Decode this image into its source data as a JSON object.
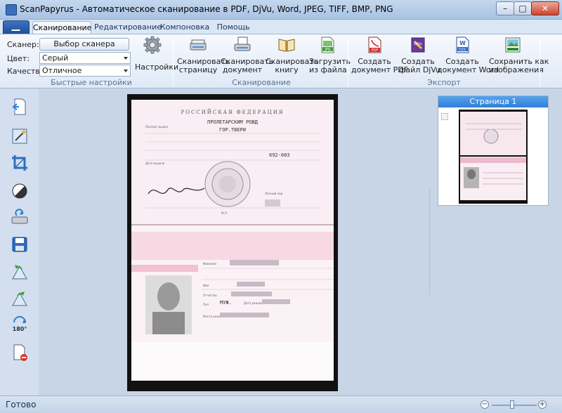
{
  "window": {
    "title": "ScanPapyrus - Автоматическое сканирование в PDF, DjVu, Word, JPEG, TIFF, BMP, PNG",
    "min": "–",
    "max": "□",
    "close": "✕"
  },
  "tabs": [
    {
      "label": "Сканирование",
      "active": true
    },
    {
      "label": "Редактирование",
      "active": false
    },
    {
      "label": "Компоновка",
      "active": false
    },
    {
      "label": "Помощь",
      "active": false
    }
  ],
  "quick_settings": {
    "scanner_label": "Сканер:",
    "scanner_button": "Выбор сканера",
    "color_label": "Цвет:",
    "color_value": "Серый",
    "quality_label": "Качество:",
    "quality_value": "Отличное",
    "settings_button": "Настройки",
    "caption": "Быстрые настройки"
  },
  "scan_group": {
    "caption": "Сканирование",
    "buttons": [
      {
        "line1": "Сканировать",
        "line2": "страницу"
      },
      {
        "line1": "Сканировать",
        "line2": "документ"
      },
      {
        "line1": "Сканировать",
        "line2": "книгу"
      },
      {
        "line1": "Загрузить",
        "line2": "из файла"
      }
    ]
  },
  "export_group": {
    "caption": "Экспорт",
    "buttons": [
      {
        "line1": "Создать",
        "line2": "документ PDF"
      },
      {
        "line1": "Создать",
        "line2": "файл DjVu"
      },
      {
        "line1": "Создать",
        "line2": "документ Word"
      },
      {
        "line1": "Сохранить как",
        "line2": "изображения"
      }
    ]
  },
  "icons": {
    "pdf": "PDF",
    "djvu": "DjVu",
    "doc": "DOC",
    "jpg": "JPG",
    "rotate": "180°"
  },
  "thumbnail": {
    "title": "Страница 1"
  },
  "document": {
    "header": "РОССИЙСКАЯ ФЕДЕРАЦИЯ",
    "issued_by_line1": "ПРОЛЕТАРСКИМ РОВД",
    "issued_by_line2": "ГОР.ТВЕРИ",
    "issued_by_label": "Паспорт выдан",
    "issue_date_label": "Дата выдачи",
    "division_code": "692-003",
    "signature_label": "Личный код",
    "mp": "М.П.",
    "surname_label": "Фамилия",
    "name_label": "Имя",
    "patronymic_label": "Отчество",
    "sex_label": "Пол",
    "sex_value": "МУЖ.",
    "dob_label": "Дата рождения",
    "pob_label": "Место рождения"
  },
  "status": {
    "text": "Готово",
    "zoom_out": "−",
    "zoom_in": "+",
    "zoom_level": 0.45
  },
  "colors": {
    "accent": "#2f7fd6",
    "ribbon": "#dfe9f6",
    "workspace": "#c8d5e6"
  }
}
